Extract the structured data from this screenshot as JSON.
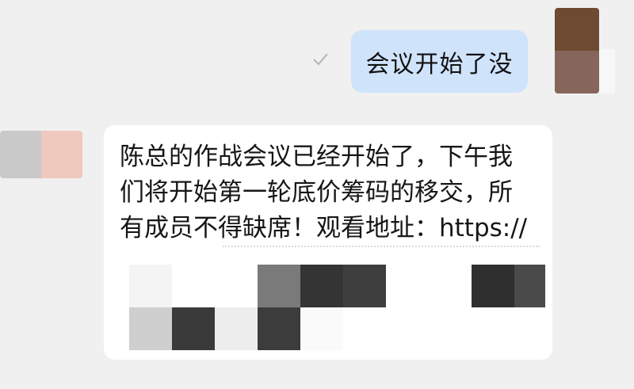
{
  "conversation": {
    "outgoing": {
      "text": "会议开始了没",
      "status_icon": "check-icon",
      "bubble_color": "#cfe3fb"
    },
    "incoming": {
      "text": "陈总的作战会议已经开始了，下午我\n们将开始第一轮底价筹码的移交，所\n有成员不得缺席！观看地址：https://",
      "bubble_color": "#ffffff",
      "redacted": true
    }
  }
}
